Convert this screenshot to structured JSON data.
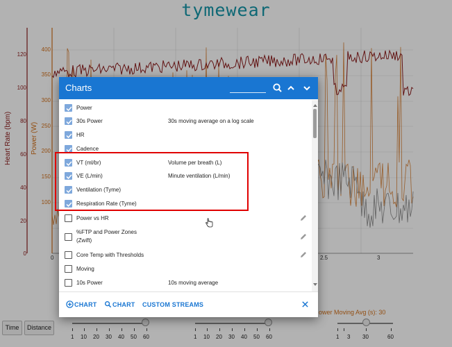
{
  "logo": "tymewear",
  "colors": {
    "hr_line": "#8b1a1a",
    "power_line": "#d2701a",
    "header_blue": "#1976d2",
    "highlight_red": "#e00000",
    "checkbox_checked": "#7ea8dc"
  },
  "chart": {
    "hr_axis_title": "Heart Rate (bpm)",
    "power_axis_title": "Power (W)",
    "hr_ticks": [
      "120",
      "100",
      "80",
      "60",
      "40",
      "20",
      "0"
    ],
    "power_ticks": [
      "400",
      "350",
      "300",
      "250",
      "200",
      "150",
      "100"
    ],
    "x_ticks": [
      "0",
      "2.5",
      "3"
    ]
  },
  "bottom": {
    "time_button": "Time",
    "distance_button": "Distance",
    "power_moving_avg_label": "ower Moving Avg (s): 30",
    "slider_ticks_left": [
      "1",
      "10",
      "20",
      "30",
      "40",
      "50",
      "60"
    ],
    "slider_ticks_middle": [
      "1",
      "10",
      "20",
      "30",
      "40",
      "50",
      "60"
    ],
    "slider_ticks_right": [
      "1",
      "3",
      "30",
      "60"
    ]
  },
  "dialog": {
    "title": "Charts",
    "header_icons": [
      "search-icon",
      "chevron-up-icon",
      "chevron-down-icon"
    ],
    "items": [
      {
        "label": "Power",
        "description": "",
        "checked": true,
        "editable": false
      },
      {
        "label": "30s Power",
        "description": "30s moving average on a log scale",
        "checked": true,
        "editable": false
      },
      {
        "label": "HR",
        "description": "",
        "checked": true,
        "editable": false
      },
      {
        "label": "Cadence",
        "description": "",
        "checked": true,
        "editable": false
      },
      {
        "label": "VT (ml/br)",
        "description": "Volume per breath (L)",
        "checked": true,
        "editable": false
      },
      {
        "label": "VE (L/min)",
        "description": "Minute ventilation (L/min)",
        "checked": true,
        "editable": false
      },
      {
        "label": "Ventilation (Tyme)",
        "description": "",
        "checked": true,
        "editable": false
      },
      {
        "label": "Respiration Rate (Tyme)",
        "description": "",
        "checked": true,
        "editable": false
      },
      {
        "label": "Power vs HR",
        "description": "",
        "checked": false,
        "editable": true
      },
      {
        "label": "%FTP and Power Zones",
        "label2": "(Zwift)",
        "description": "",
        "checked": false,
        "editable": true
      },
      {
        "label": "Core Temp with Thresholds",
        "description": "",
        "checked": false,
        "editable": true
      },
      {
        "label": "Moving",
        "description": "",
        "checked": false,
        "editable": false
      },
      {
        "label": "10s Power",
        "description": "10s moving average",
        "checked": false,
        "editable": false
      }
    ],
    "footer": {
      "add_chart": "CHART",
      "search_chart": "CHART",
      "custom_streams": "CUSTOM STREAMS"
    }
  }
}
